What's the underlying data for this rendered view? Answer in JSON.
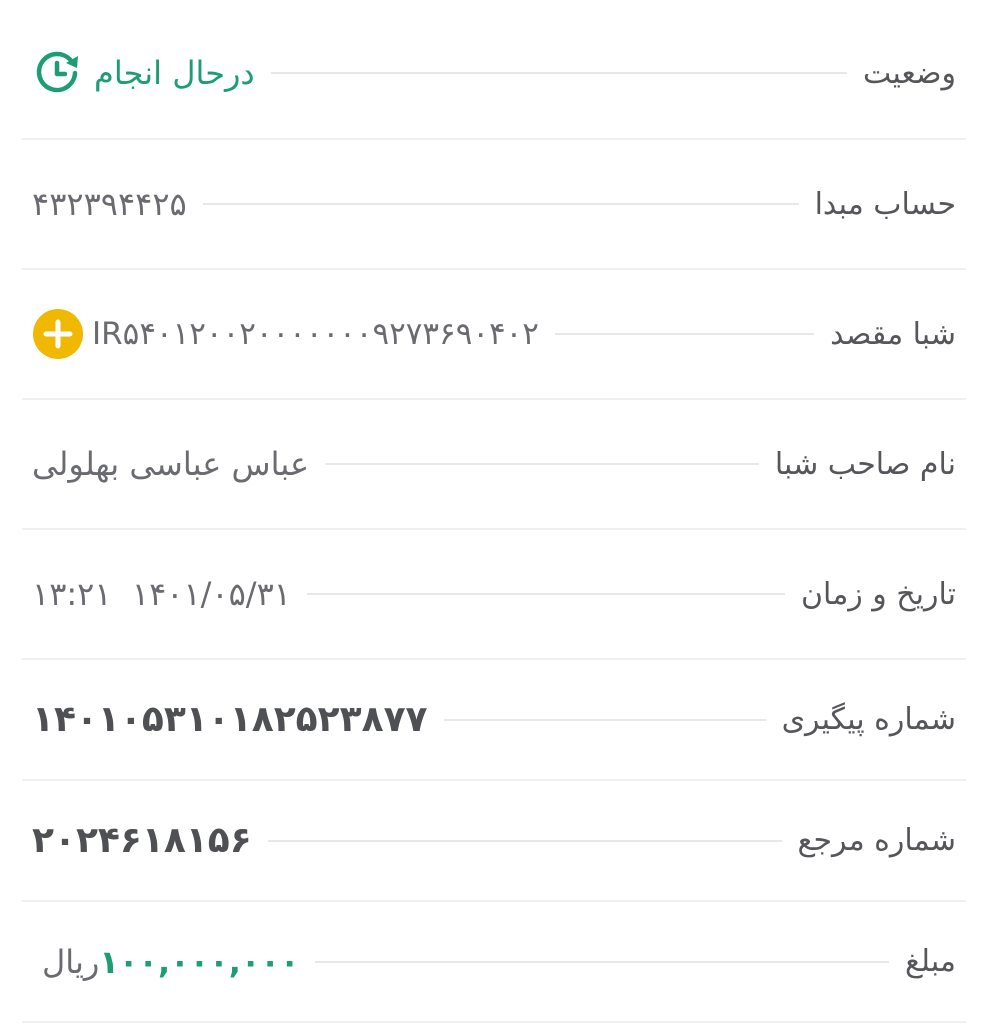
{
  "rows": {
    "status": {
      "label": "وضعیت",
      "value": "درحال انجام",
      "icon": "clock-refresh-icon",
      "color": "#1c9e72"
    },
    "source_account": {
      "label": "حساب مبدا",
      "value": "۴۳۲۳۹۴۴۲۵"
    },
    "dest_sheba": {
      "label": "شبا مقصد",
      "value": "IR۵۴۰۱۲۰۰۲۰۰۰۰۰۰۰۹۲۷۳۶۹۰۴۰۲",
      "icon": "add-circle-icon",
      "icon_color": "#f0b800"
    },
    "sheba_owner": {
      "label": "نام صاحب شبا",
      "value": "عباس عباسی بهلولی"
    },
    "datetime": {
      "label": "تاریخ و زمان",
      "value": "۱۴۰۱/۰۵/۳۱  ۱۳:۲۱"
    },
    "tracking": {
      "label": "شماره پیگیری",
      "value": "۱۴۰۱۰۵۳۱۰۱۸۲۵۲۳۸۷۷"
    },
    "reference": {
      "label": "شماره مرجع",
      "value": "۲۰۲۴۶۱۸۱۵۶"
    },
    "amount": {
      "label": "مبلغ",
      "value": "۱۰۰,۰۰۰,۰۰۰",
      "currency": "ریال",
      "color": "#1c9e72"
    }
  }
}
